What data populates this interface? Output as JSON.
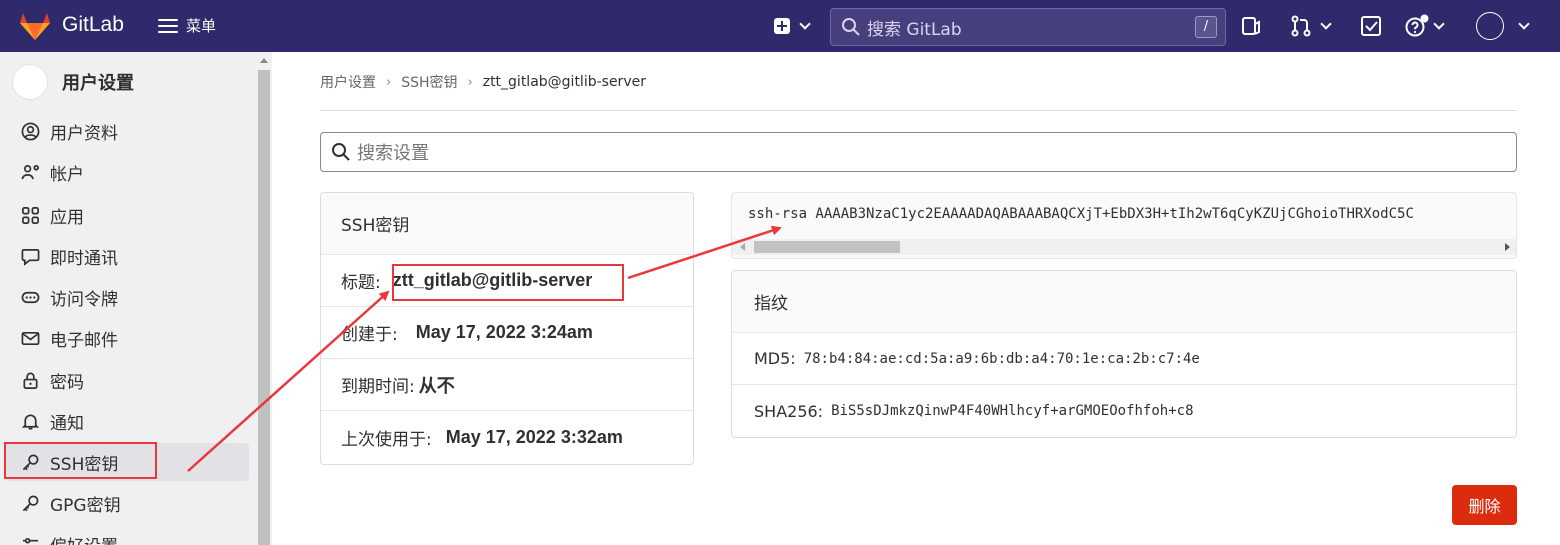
{
  "navbar": {
    "brand": "GitLab",
    "menu_label": "菜单",
    "search_placeholder": "搜索 GitLab",
    "search_shortcut": "/",
    "bg_color": "#2f2a6b"
  },
  "sidebar": {
    "title": "用户设置",
    "items": [
      {
        "label": "用户资料",
        "icon": "profile-icon"
      },
      {
        "label": "帐户",
        "icon": "account-icon"
      },
      {
        "label": "应用",
        "icon": "applications-icon"
      },
      {
        "label": "即时通讯",
        "icon": "chat-icon"
      },
      {
        "label": "访问令牌",
        "icon": "token-icon"
      },
      {
        "label": "电子邮件",
        "icon": "mail-icon"
      },
      {
        "label": "密码",
        "icon": "lock-icon"
      },
      {
        "label": "通知",
        "icon": "bell-icon"
      },
      {
        "label": "SSH密钥",
        "icon": "key-icon",
        "active": true
      },
      {
        "label": "GPG密钥",
        "icon": "key-icon"
      },
      {
        "label": "偏好设置",
        "icon": "preferences-icon"
      }
    ]
  },
  "breadcrumb": [
    "用户设置",
    "SSH密钥",
    "ztt_gitlab@gitlib-server"
  ],
  "settings_search_placeholder": "搜索设置",
  "ssh_card": {
    "header": "SSH密钥",
    "title_label": "标题:",
    "title_value": "ztt_gitlab@gitlib-server",
    "created_label": "创建于:",
    "created_value": "May 17, 2022 3:24am",
    "expires_label": "到期时间:",
    "expires_value": "从不",
    "last_used_label": "上次使用于:",
    "last_used_value": "May 17, 2022 3:32am"
  },
  "key_text": "ssh-rsa AAAAB3NzaC1yc2EAAAADAQABAAABAQCXjT+EbDX3H+tIh2wT6qCyKZUjCGhoioTHRXodC5C",
  "fingerprints": {
    "header": "指纹",
    "md5_label": "MD5:",
    "md5_value": "78:b4:84:ae:cd:5a:a9:6b:db:a4:70:1e:ca:2b:c7:4e",
    "sha256_label": "SHA256:",
    "sha256_value": "BiS5sDJmkzQinwP4F40WHlhcyf+arGMOEOofhfoh+c8"
  },
  "delete_button": "删除",
  "colors": {
    "danger": "#dd2b0e",
    "annotation": "#e8383d"
  }
}
